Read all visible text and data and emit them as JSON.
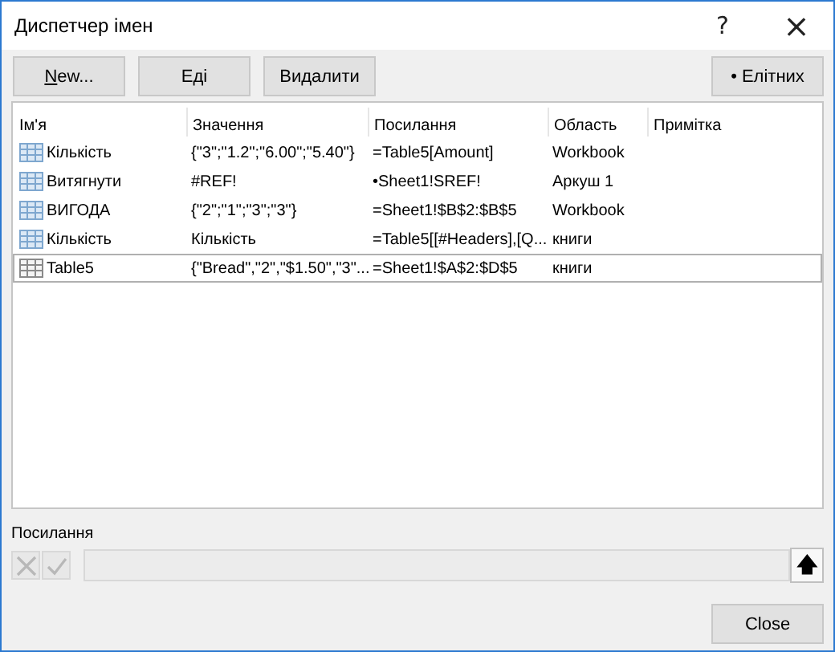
{
  "window": {
    "title": "Диспетчер імен",
    "help": "?",
    "close": "×"
  },
  "toolbar": [
    {
      "label": "New..."
    },
    {
      "label": "Еді"
    },
    {
      "label": "Видалити"
    }
  ],
  "filter_button": "• Елітних",
  "table": {
    "columns": [
      "Ім'я",
      "Значення",
      "Посилання",
      "Область",
      "Примітка"
    ],
    "rows": [
      {
        "kind": "range",
        "selected": false,
        "cells": [
          "Кількість",
          "{\"3\";\"1.2\";\"6.00\";\"5.40\"}",
          "=Table5[Amount]",
          "Workbook",
          ""
        ]
      },
      {
        "kind": "range",
        "selected": false,
        "cells": [
          "Витягнути",
          "#REF!",
          "•Sheet1!SREF!",
          "Аркуш 1",
          ""
        ]
      },
      {
        "kind": "range",
        "selected": false,
        "cells": [
          "ВИГОДА",
          "{\"2\";\"1\";\"3\";\"3\"}",
          "=Sheet1!$B$2:$B$5",
          "Workbook",
          ""
        ]
      },
      {
        "kind": "range",
        "selected": false,
        "cells": [
          "Кількість",
          "Кількість",
          "=Table5[[#Headers],[Q...",
          "книги",
          ""
        ]
      },
      {
        "kind": "table",
        "selected": true,
        "cells": [
          "Table5",
          "{\"Bread\",\"2\",\"$1.50\",\"3\"...",
          "=Sheet1!$A$2:$D$5",
          "книги",
          ""
        ]
      }
    ]
  },
  "refers_to": {
    "label": "Посилання",
    "arrow": "🡅"
  },
  "close_button": "Close"
}
